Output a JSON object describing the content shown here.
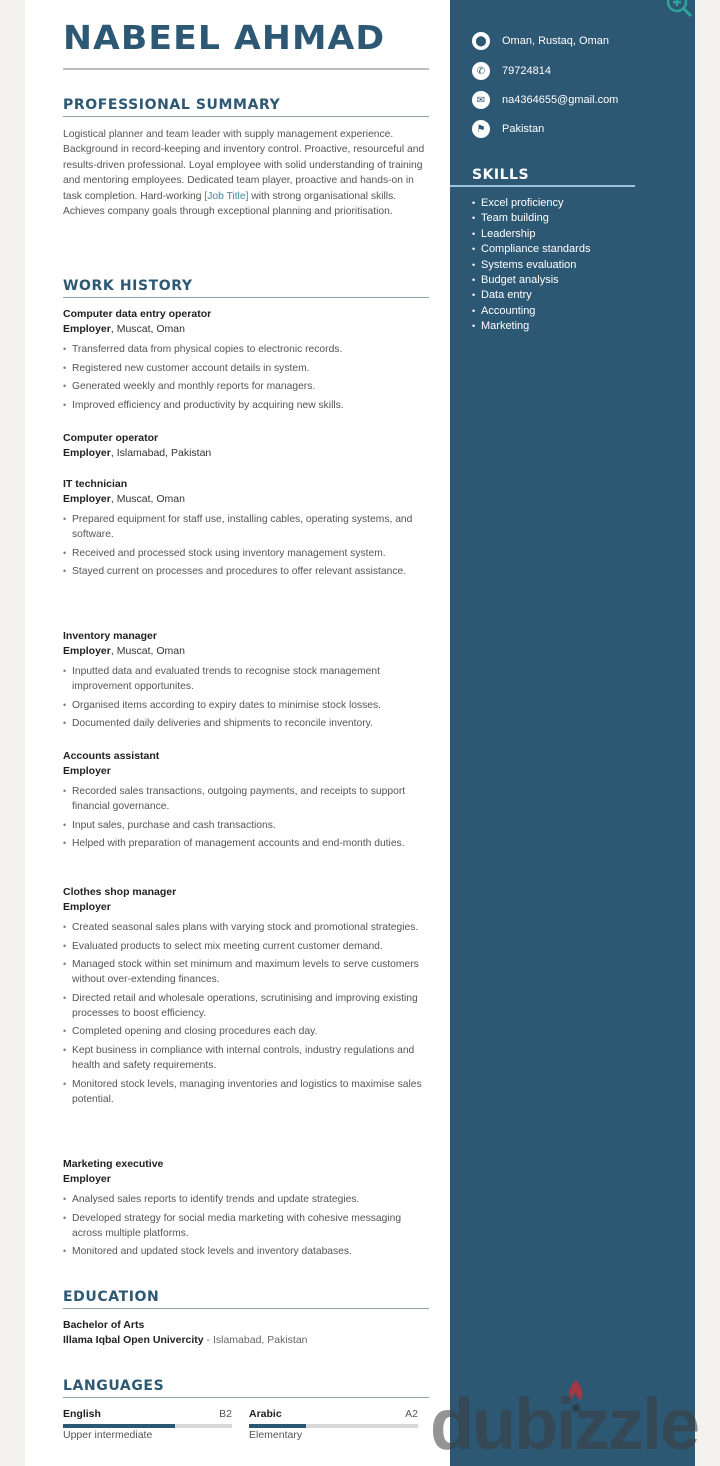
{
  "resume": {
    "name": "NABEEL AHMAD",
    "contact": [
      {
        "icon": "location-pin-icon",
        "glyph": "⬤",
        "text": "Oman, Rustaq, Oman"
      },
      {
        "icon": "phone-icon",
        "glyph": "✆",
        "text": "79724814"
      },
      {
        "icon": "email-icon",
        "glyph": "✉",
        "text": "na4364655@gmail.com"
      },
      {
        "icon": "flag-icon",
        "glyph": "⚑",
        "text": "Pakistan"
      }
    ],
    "skills": {
      "title": "SKILLS",
      "items": [
        "Excel proficiency",
        "Team building",
        "Leadership",
        "Compliance standards",
        "Systems evaluation",
        "Budget analysis",
        "Data entry",
        "Accounting",
        "Marketing"
      ]
    },
    "summary": {
      "title": "PROFESSIONAL SUMMARY",
      "before_link": "Logistical planner and team leader with supply management experience. Background in record-keeping and inventory control. Proactive, resourceful and results-driven professional. Loyal employee with solid understanding of training and mentoring employees. Dedicated team player, proactive and hands-on in task completion. Hard-working ",
      "link": "[Job Title]",
      "after_link": " with strong organisational skills. Achieves company goals through exceptional planning and prioritisation."
    },
    "work_history": {
      "title": "WORK HISTORY",
      "jobs": [
        {
          "title": "Computer data entry operator",
          "employer": "Employer",
          "location": ", Muscat, Oman",
          "bullets": [
            "Transferred data from physical copies to electronic records.",
            "Registered new customer account details in system.",
            "Generated weekly and monthly reports for managers.",
            "Improved efficiency and productivity by acquiring new skills."
          ]
        },
        {
          "title": "Computer operator",
          "employer": "Employer",
          "location": ", Islamabad, Pakistan",
          "bullets": []
        },
        {
          "title": "IT technician",
          "employer": "Employer",
          "location": ", Muscat, Oman",
          "bullets": [
            "Prepared equipment for staff use, installing cables, operating systems, and software.",
            "Received and processed stock using inventory management system.",
            "Stayed current on processes and procedures to offer relevant assistance."
          ]
        },
        {
          "title": "Inventory manager",
          "employer": "Employer",
          "location": ", Muscat, Oman",
          "bullets": [
            "Inputted data and evaluated trends to recognise stock management improvement opportunites.",
            "Organised items according to expiry dates to minimise stock losses.",
            "Documented daily deliveries and shipments to reconcile inventory."
          ]
        },
        {
          "title": "Accounts assistant",
          "employer": "Employer",
          "location": "",
          "bullets": [
            "Recorded sales transactions, outgoing payments, and receipts to support financial governance.",
            "Input sales, purchase and cash transactions.",
            "Helped with preparation of management accounts and end-month duties."
          ]
        },
        {
          "title": "Clothes shop manager",
          "employer": "Employer",
          "location": "",
          "bullets": [
            "Created seasonal sales plans with varying stock and promotional strategies.",
            "Evaluated products to select mix meeting current customer demand.",
            "Managed stock within set minimum and maximum levels to serve customers without over-extending finances.",
            "Directed retail and wholesale operations, scrutinising and improving existing processes to boost efficiency.",
            "Completed opening and closing procedures each day.",
            "Kept business in compliance with internal controls, industry regulations and health and safety requirements.",
            "Monitored stock levels, managing inventories and logistics to maximise sales potential."
          ]
        },
        {
          "title": "Marketing executive",
          "employer": "Employer",
          "location": "",
          "bullets": [
            "Analysed sales reports to identify trends and update strategies.",
            "Developed strategy for social media marketing with cohesive messaging across multiple platforms.",
            "Monitored and updated stock levels and inventory databases."
          ]
        }
      ]
    },
    "education": {
      "title": "EDUCATION",
      "degree": "Bachelor of Arts",
      "school": "Illama Iqbal Open Univercity",
      "location": " - Islamabad, Pakistan"
    },
    "languages": {
      "title": "LANGUAGES",
      "items": [
        {
          "name": "English",
          "level": "B2",
          "description": "Upper intermediate",
          "proficiency": 0.66
        },
        {
          "name": "Arabic",
          "level": "A2",
          "description": "Elementary",
          "proficiency": 0.34
        }
      ]
    }
  },
  "overlay": {
    "zoom_icon": "zoom-in-icon",
    "watermark": "dubizzle"
  },
  "colors": {
    "accent": "#2d5874",
    "sidebar": "#2d5874",
    "link": "#3f8a9b",
    "watermark_flame": "#c0392b"
  }
}
